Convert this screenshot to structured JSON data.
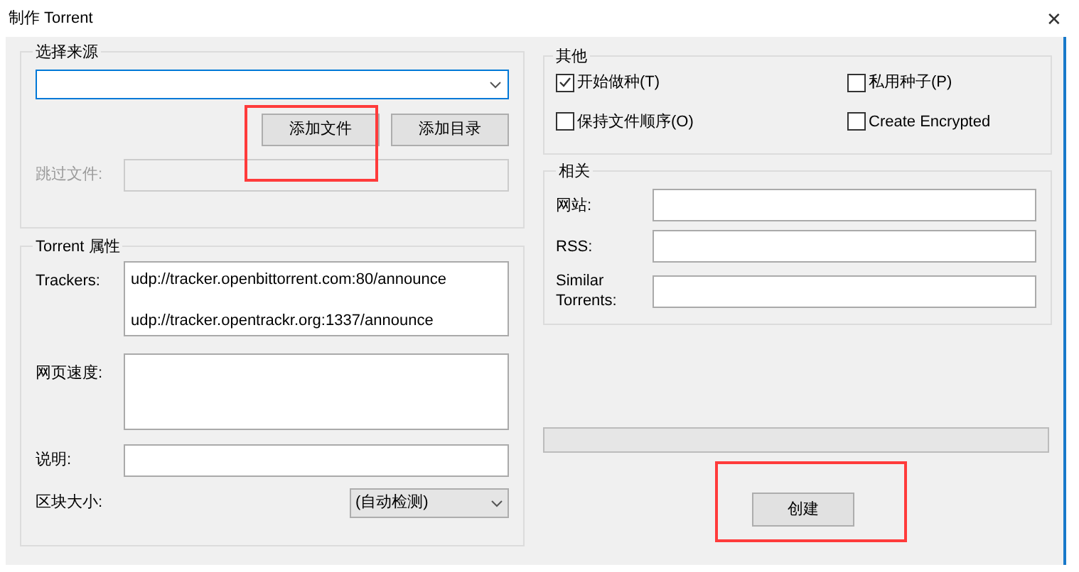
{
  "window": {
    "title": "制作 Torrent",
    "close": "✕"
  },
  "source": {
    "title": "选择来源",
    "buttons": [
      "添加文件",
      "添加目录"
    ],
    "skip_label": "跳过文件:",
    "skip_disabled": true
  },
  "properties": {
    "title": "Torrent 属性",
    "trackers_label": "Trackers:",
    "trackers": [
      "udp://tracker.openbittorrent.com:80/announce",
      "udp://tracker.opentrackr.org:1337/announce"
    ],
    "web_seeds_label": "网页速度:",
    "comment_label": "说明:",
    "piece_size_label": "区块大小:",
    "piece_size": "(自动检测)"
  },
  "other": {
    "title": "其他",
    "options": [
      {
        "label": "开始做种(T)",
        "checked": true
      },
      {
        "label": "私用种子(P)",
        "checked": false
      },
      {
        "label": "保持文件顺序(O)",
        "checked": false
      },
      {
        "label": "Create Encrypted",
        "checked": false
      }
    ]
  },
  "related": {
    "title": "相关",
    "fields": [
      {
        "label": "网站:"
      },
      {
        "label": "RSS:"
      },
      {
        "label": "Similar Torrents:"
      }
    ]
  },
  "progress": {
    "level": 0
  },
  "create_button": "创建"
}
